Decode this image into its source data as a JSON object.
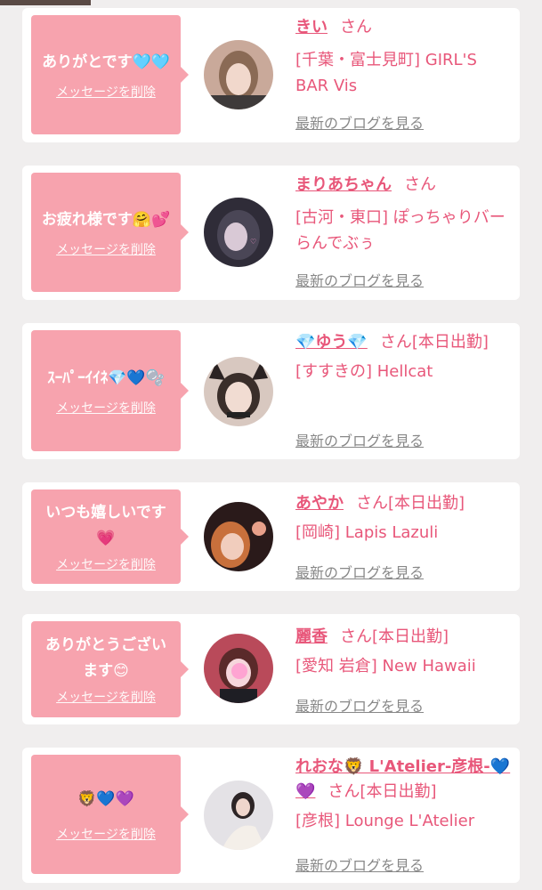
{
  "delete_label": "メッセージを削除",
  "blog_label": "最新のブログを見る",
  "san_label": "さん",
  "cards": [
    {
      "message": "ありがとです🩵🩵",
      "name": "きい",
      "status": "",
      "shop": "[千葉・富士見町] GIRL'S BAR Vis"
    },
    {
      "message": "お疲れ様です🤗💕",
      "name": "まりあちゃん",
      "status": "",
      "shop": "[古河・東口] ぽっちゃりバー らんでぶぅ"
    },
    {
      "message": "ｽｰﾊﾟｰｲｲﾈ💎💙🫧",
      "name": "💎ゆう💎",
      "status": "[本日出勤]",
      "shop": "[すすきの] Hellcat"
    },
    {
      "message": "いつも嬉しいです💗",
      "name": "あやか",
      "status": "[本日出勤]",
      "shop": "[岡崎] Lapis Lazuli"
    },
    {
      "message": "ありがとうございます😊",
      "name": "麗香",
      "status": "[本日出勤]",
      "shop": "[愛知 岩倉] New Hawaii"
    },
    {
      "message": "🦁💙💜",
      "name": "れおな🦁 L'Atelier-彦根-💙💜",
      "status": "[本日出勤]",
      "shop": "[彦根] Lounge L'Atelier"
    }
  ]
}
